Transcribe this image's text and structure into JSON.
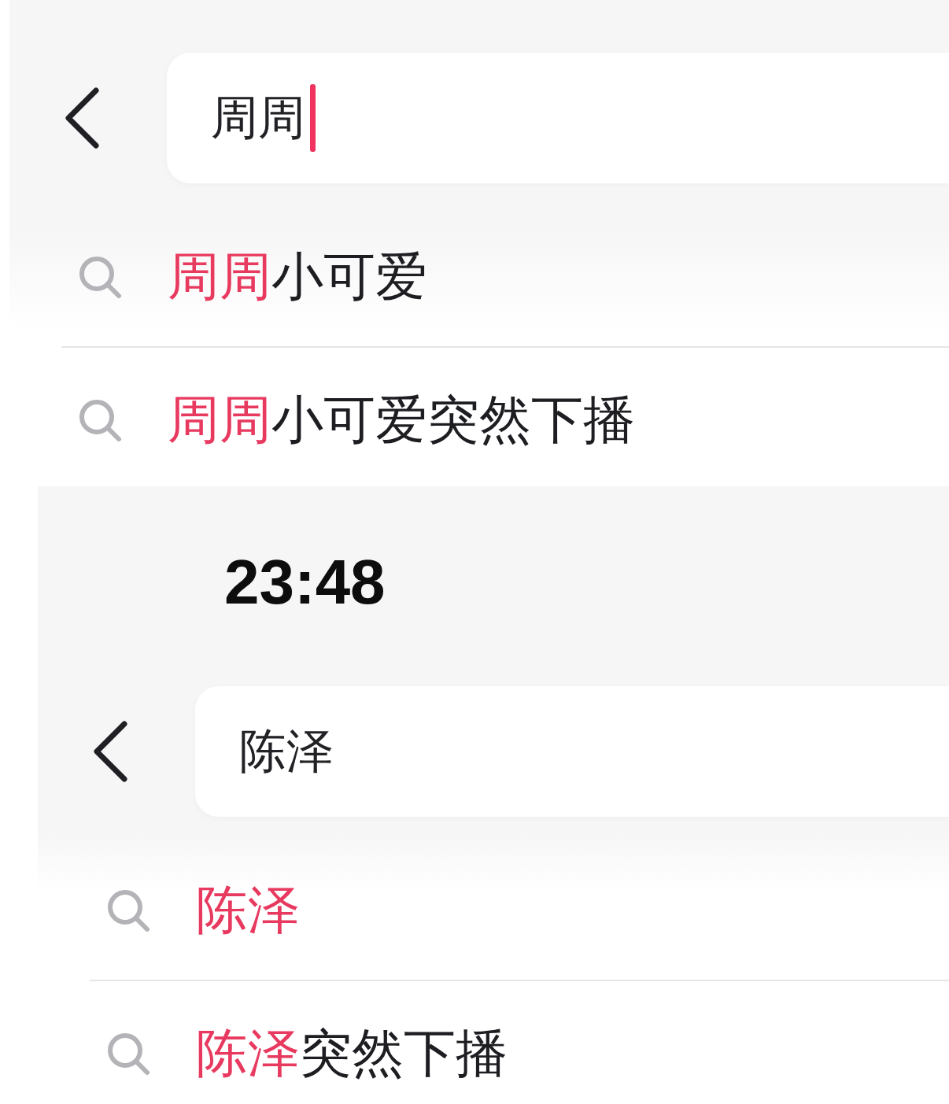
{
  "screenshots": [
    {
      "search": {
        "value": "周周",
        "cursor": true
      },
      "suggestions": [
        {
          "match": "周周",
          "rest": "小可爱"
        },
        {
          "match": "周周",
          "rest": "小可爱突然下播"
        }
      ]
    },
    {
      "status_bar": {
        "time": "23:48"
      },
      "search": {
        "value": "陈泽",
        "cursor": false
      },
      "suggestions": [
        {
          "match": "陈泽"
        },
        {
          "match": "陈泽",
          "rest": "突然下播"
        }
      ]
    }
  ]
}
